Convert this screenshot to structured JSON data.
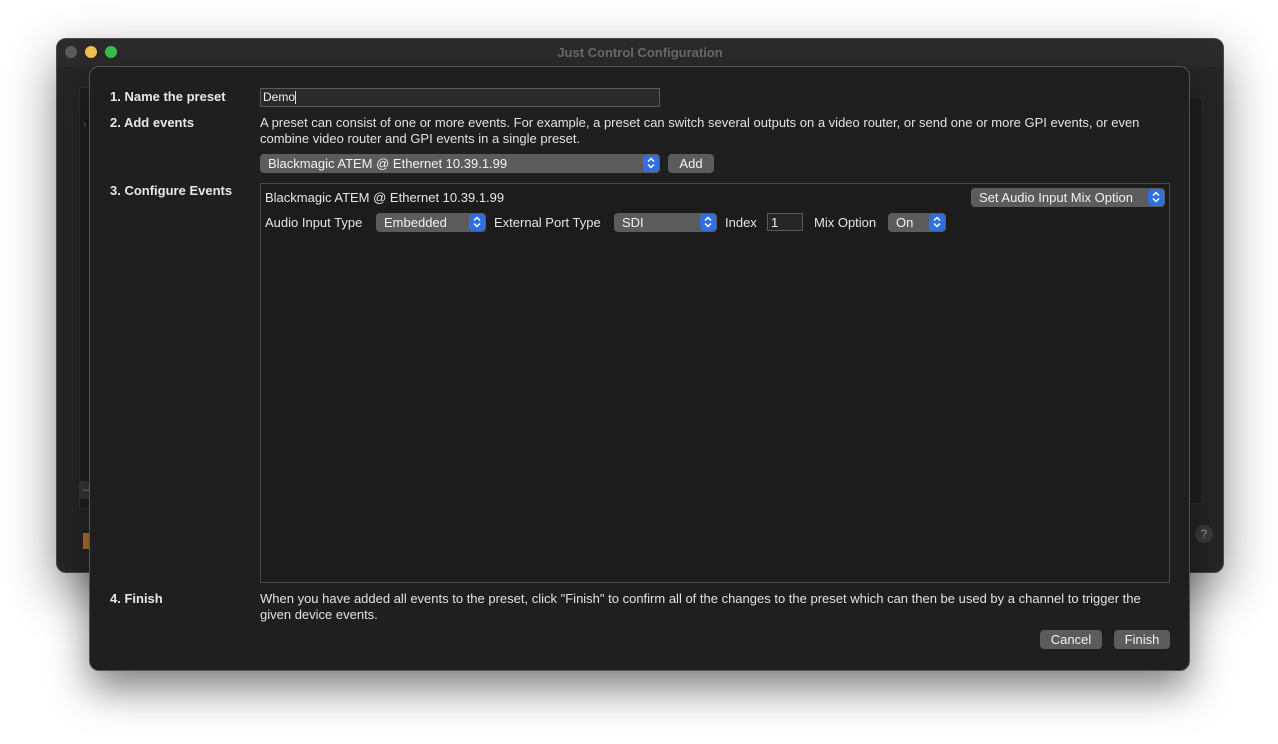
{
  "window": {
    "title": "Just Control Configuration"
  },
  "background": {
    "chevron": "›",
    "minus_label": "–",
    "help_label": "?"
  },
  "sheet": {
    "step1": {
      "label": "1. Name the preset",
      "value": "Demo"
    },
    "step2": {
      "label": "2. Add events",
      "description": "A preset can consist of one or more events. For example, a preset can switch several outputs on a video router, or send one or more GPI events, or even combine video router and GPI events in a single preset.",
      "device_selected": "Blackmagic ATEM @ Ethernet 10.39.1.99",
      "add_label": "Add"
    },
    "step3": {
      "label": "3. Configure Events",
      "event": {
        "device": "Blackmagic ATEM @ Ethernet 10.39.1.99",
        "action_selected": "Set Audio Input Mix Option",
        "audio_input_type_label": "Audio Input Type",
        "audio_input_type_value": "Embedded",
        "external_port_type_label": "External Port Type",
        "external_port_type_value": "SDI",
        "index_label": "Index",
        "index_value": "1",
        "mix_option_label": "Mix Option",
        "mix_option_value": "On"
      }
    },
    "step4": {
      "label": "4. Finish",
      "description": "When you have added all events to the preset, click \"Finish\" to confirm all of the changes to the preset which can then be used by a channel to trigger the given device events."
    },
    "buttons": {
      "cancel": "Cancel",
      "finish": "Finish"
    }
  },
  "colors": {
    "accent": "#2f6fe0",
    "sheet_bg": "#1f1f1f",
    "control_bg": "#5c5c5c",
    "traffic_close": "#5b5b5b",
    "traffic_min": "#f5bf4f",
    "traffic_max": "#3ac14a"
  }
}
